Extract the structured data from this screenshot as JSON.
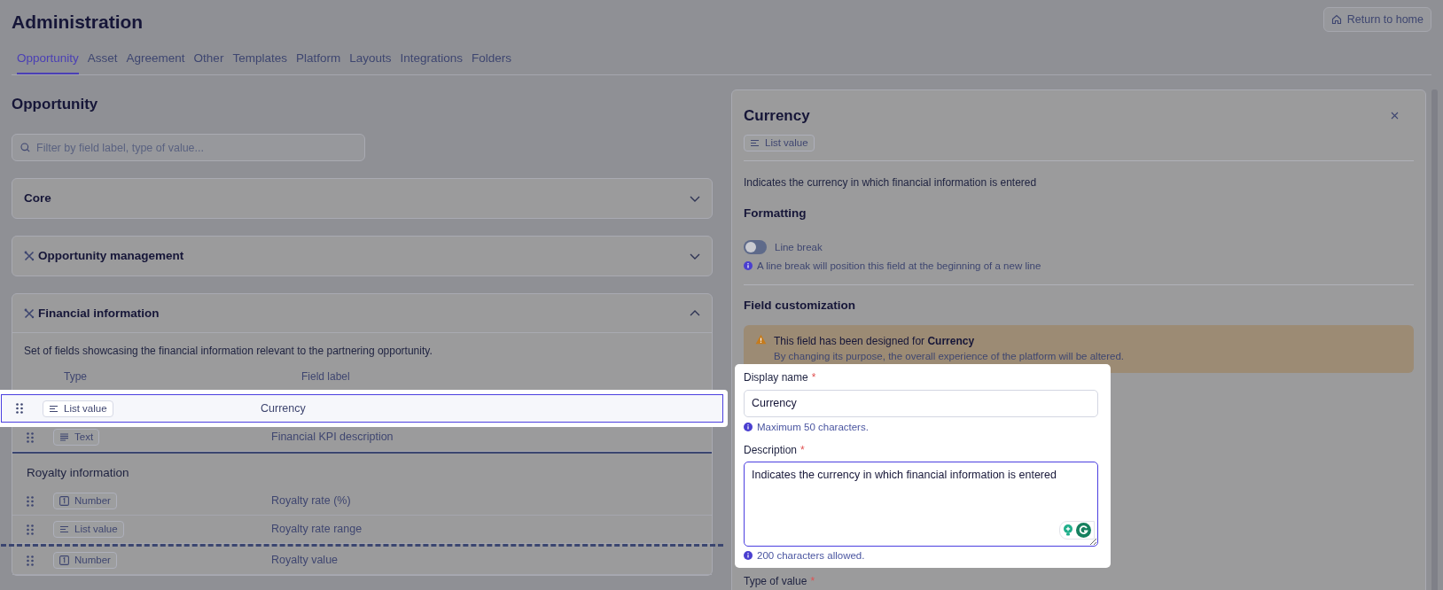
{
  "page": {
    "title": "Administration",
    "return_button": "Return to home"
  },
  "tabs": [
    {
      "label": "Opportunity",
      "selected": true
    },
    {
      "label": "Asset",
      "selected": false
    },
    {
      "label": "Agreement",
      "selected": false
    },
    {
      "label": "Other",
      "selected": false
    },
    {
      "label": "Templates",
      "selected": false
    },
    {
      "label": "Platform",
      "selected": false
    },
    {
      "label": "Layouts",
      "selected": false
    },
    {
      "label": "Integrations",
      "selected": false
    },
    {
      "label": "Folders",
      "selected": false
    }
  ],
  "section_title": "Opportunity",
  "search": {
    "placeholder": "Filter by field label, type of value..."
  },
  "sections": [
    {
      "title": "Core",
      "custom": false,
      "expanded": false
    },
    {
      "title": "Opportunity management",
      "custom": true,
      "expanded": false
    },
    {
      "title": "Financial information",
      "custom": true,
      "expanded": true,
      "description": "Set of fields showcasing the financial information relevant to the partnering opportunity.",
      "columns": [
        "Type",
        "Field label"
      ],
      "rows": [
        {
          "kind": "field",
          "type": {
            "label": "List value",
            "kind": "list"
          },
          "label": "Currency",
          "selected": true,
          "drop_line_below": false
        },
        {
          "kind": "field",
          "type": {
            "label": "Text",
            "kind": "text"
          },
          "label": "Financial KPI description",
          "selected": false,
          "drop_line_below": false
        },
        {
          "kind": "group",
          "title": "Royalty information"
        },
        {
          "kind": "field",
          "type": {
            "label": "Number",
            "kind": "number"
          },
          "label": "Royalty rate (%)",
          "selected": false,
          "drop_line_below": false
        },
        {
          "kind": "field",
          "type": {
            "label": "List value",
            "kind": "list"
          },
          "label": "Royalty rate range",
          "selected": false,
          "drop_line_below": true
        },
        {
          "kind": "field",
          "type": {
            "label": "Number",
            "kind": "number"
          },
          "label": "Royalty value",
          "selected": false,
          "drop_line_below": false
        }
      ]
    }
  ],
  "panel": {
    "title": "Currency",
    "type": {
      "label": "List value",
      "kind": "list"
    },
    "description": "Indicates the currency in which financial information is entered",
    "formatting": {
      "title": "Formatting",
      "line_break": {
        "label": "Line break",
        "on": false,
        "hint": "A line break will position this field at the beginning of a new line"
      }
    },
    "customization": {
      "title": "Field customization",
      "warning": {
        "text": "This field has been designed for **Currency**",
        "detail": "By changing its purpose, the overall experience of the platform will be altered."
      },
      "display_name": {
        "label": "Display name",
        "required_mark": "*",
        "value": "Currency",
        "hint": "Maximum 50 characters."
      },
      "description": {
        "label": "Description",
        "required_mark": "*",
        "value": "Indicates the currency in which financial information is entered",
        "hint": "200 characters allowed."
      },
      "type_of_value": {
        "label": "Type of value",
        "required_mark": "*"
      }
    }
  }
}
